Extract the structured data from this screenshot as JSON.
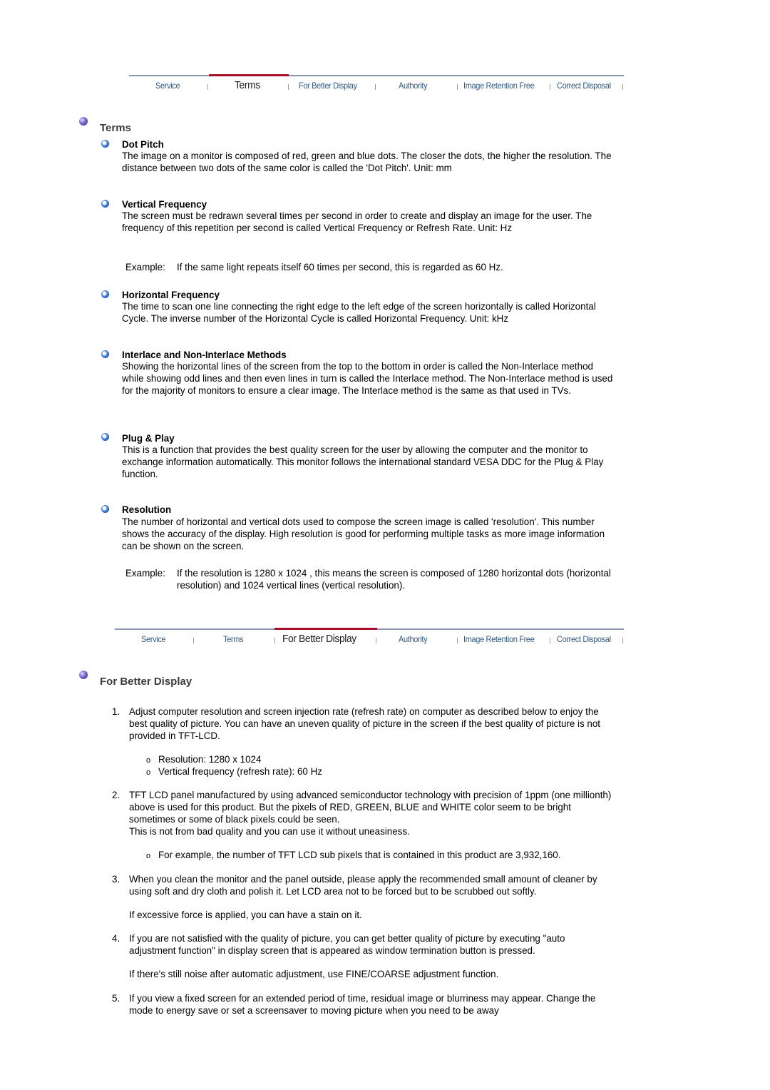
{
  "nav_top": {
    "tabs": [
      {
        "label": "Service"
      },
      {
        "label": "Terms"
      },
      {
        "label": "For Better Display"
      },
      {
        "label": "Authority"
      },
      {
        "label": "Image Retention Free"
      },
      {
        "label": "Correct Disposal"
      }
    ],
    "active": "Terms"
  },
  "terms": {
    "title": "Terms",
    "items": [
      {
        "title": "Dot Pitch",
        "text": "The image on a monitor is composed of red, green and blue dots. The closer the dots, the higher the resolution. The distance between two dots of the same color is called the 'Dot Pitch'. Unit: mm"
      },
      {
        "title": "Vertical Frequency",
        "text": "The screen must be redrawn several times per second in order to create and display an image for the user. The frequency of this repetition per second is called Vertical Frequency or Refresh Rate. Unit: Hz",
        "example_label": "Example:",
        "example_text": "If the same light repeats itself 60 times per second, this is regarded as 60 Hz."
      },
      {
        "title": "Horizontal Frequency",
        "text": "The time to scan one line connecting the right edge to the left edge of the screen horizontally is called Horizontal Cycle. The inverse number of the Horizontal Cycle is called Horizontal Frequency. Unit: kHz"
      },
      {
        "title": "Interlace and Non-Interlace Methods",
        "text": "Showing the horizontal lines of the screen from the top to the bottom in order is called the Non-Interlace method while showing odd lines and then even lines in turn is called the Interlace method. The Non-Interlace method is used for the majority of monitors to ensure a clear image. The Interlace method is the same as that used in TVs."
      },
      {
        "title": "Plug & Play",
        "text": "This is a function that provides the best quality screen for the user by allowing the computer and the monitor to exchange information automatically. This monitor follows the international standard VESA DDC for the Plug & Play function."
      },
      {
        "title": "Resolution",
        "text": "The number of horizontal and vertical dots used to compose the screen image is called 'resolution'. This number shows the accuracy of the display. High resolution is good for performing multiple tasks as more image information can be shown on the screen.",
        "example_label": "Example:",
        "example_text": "If the resolution is 1280 x 1024 , this means the screen is composed of 1280 horizontal dots (horizontal resolution) and 1024 vertical lines (vertical resolution)."
      }
    ]
  },
  "nav_bottom": {
    "tabs": [
      {
        "label": "Service"
      },
      {
        "label": "Terms"
      },
      {
        "label": "For Better Display"
      },
      {
        "label": "Authority"
      },
      {
        "label": "Image Retention Free"
      },
      {
        "label": "Correct Disposal"
      }
    ],
    "active": "For Better Display"
  },
  "better_display": {
    "title": "For Better Display",
    "items": [
      {
        "num": "1.",
        "text": "Adjust computer resolution and screen injection rate (refresh rate) on computer as described below to enjoy the best quality of picture. You can have an uneven quality of picture in the screen if the best quality of picture is not provided in TFT-LCD.",
        "sub": [
          "Resolution: 1280 x 1024",
          "Vertical frequency (refresh rate): 60 Hz"
        ]
      },
      {
        "num": "2.",
        "text": "TFT LCD panel manufactured by using advanced semiconductor technology with precision of 1ppm (one millionth) above is used for this product. But the pixels of RED, GREEN, BLUE and WHITE color seem to be bright sometimes or some of black pixels could be seen.",
        "text2": "This is not from bad quality and you can use it without uneasiness.",
        "sub": [
          "For example, the number of TFT LCD sub pixels that is contained in this product are 3,932,160."
        ]
      },
      {
        "num": "3.",
        "text": "When you clean the monitor and the panel outside, please apply the recommended small amount of cleaner by using soft and dry cloth and polish it. Let LCD area not to be forced but to be scrubbed out softly.",
        "text2": "If excessive force is applied, you can have a stain on it."
      },
      {
        "num": "4.",
        "text": "If you are not satisfied with the quality of picture, you can get better quality of picture by executing \"auto adjustment function\" in display screen that is appeared as window termination button is pressed.",
        "text2": "If there's still noise after automatic adjustment, use FINE/COARSE adjustment function."
      },
      {
        "num": "5.",
        "text": "If you view a fixed screen for an extended period of time, residual image or blurriness may appear. Change the mode to energy save or set a screensaver to moving picture when you need to be away"
      }
    ],
    "sub_marker": "o"
  },
  "colors": {
    "nav_text": "#2f5a8a",
    "nav_rule": "#8a97ad",
    "active_bar": "#a8102a",
    "section_title": "#3c3c3c"
  }
}
